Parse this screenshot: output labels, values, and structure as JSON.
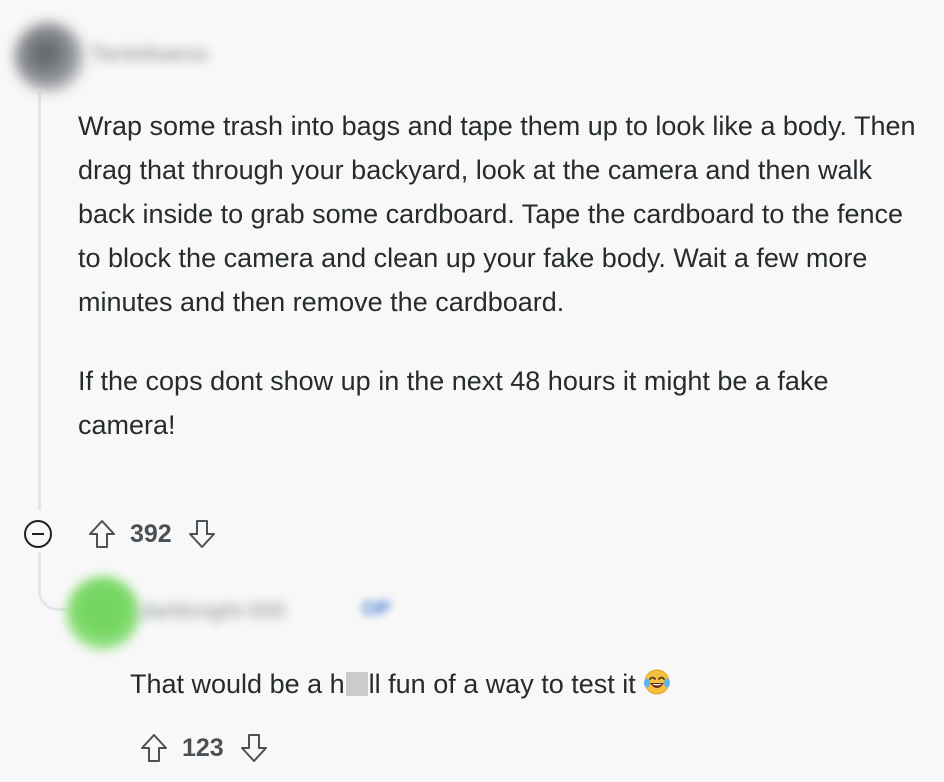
{
  "comment": {
    "username": "Tanteibaeso",
    "paragraphs": [
      "Wrap some trash into bags and tape them up to look like a body. Then drag that through your backyard, look at the camera and then walk back inside to grab some cardboard. Tape the cardboard to the fence to block the camera and clean up your fake body. Wait a few more minutes and then remove the cardboard.",
      "If the cops dont show up in the next 48 hours it might be a fake camera!"
    ],
    "score": "392",
    "icons": {
      "collapse": "minus-circle-icon",
      "upvote": "arrow-up-icon",
      "downvote": "arrow-down-icon"
    }
  },
  "reply": {
    "username": "darkknight-000",
    "badge": "OP",
    "text_before": "That would be a h",
    "text_after": "ll fun of a way to test it",
    "emoji": "face-with-tears-of-joy-emoji",
    "score": "123",
    "icons": {
      "upvote": "arrow-up-icon",
      "downvote": "arrow-down-icon"
    }
  }
}
